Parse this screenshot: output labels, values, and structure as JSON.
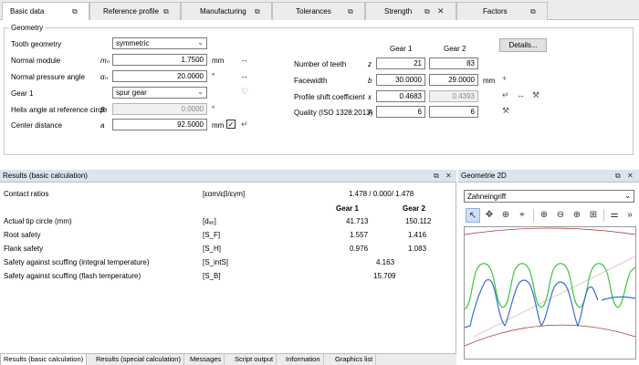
{
  "tabs": [
    {
      "label": "Basic data",
      "active": true,
      "closable": false
    },
    {
      "label": "Reference profile",
      "active": false,
      "closable": false
    },
    {
      "label": "Manufacturing",
      "active": false,
      "closable": false
    },
    {
      "label": "Tolerances",
      "active": false,
      "closable": false
    },
    {
      "label": "Strength",
      "active": false,
      "closable": true
    },
    {
      "label": "Factors",
      "active": false,
      "closable": false
    }
  ],
  "geometry": {
    "legend": "Geometry",
    "details_button": "Details...",
    "col_gear1": "Gear 1",
    "col_gear2": "Gear 2",
    "tooth_geometry": {
      "label": "Tooth geometry",
      "value": "symmetric"
    },
    "normal_module": {
      "label": "Normal module",
      "symbol": "mₙ",
      "value": "1.7500",
      "unit": "mm"
    },
    "normal_pressure_angle": {
      "label": "Normal pressure angle",
      "symbol": "αₙ",
      "value": "20.0000",
      "unit": "°"
    },
    "gear1_type": {
      "label": "Gear 1",
      "value": "spur gear"
    },
    "helix_angle": {
      "label": "Helix angle at reference circle",
      "symbol": "β",
      "value": "0.0000",
      "unit": "°"
    },
    "center_distance": {
      "label": "Center distance",
      "symbol": "a",
      "value": "92.5000",
      "unit": "mm",
      "check": "✓"
    },
    "number_of_teeth": {
      "label": "Number of teeth",
      "symbol": "z",
      "gear1": "21",
      "gear2": "83"
    },
    "facewidth": {
      "label": "Facewidth",
      "symbol": "b",
      "gear1": "30.0000",
      "gear2": "29.0000",
      "unit": "mm"
    },
    "profile_shift": {
      "label": "Profile shift coefficient",
      "symbol": "x",
      "gear1": "0.4683",
      "gear2": "0.4393"
    },
    "quality": {
      "label": "Quality (ISO 1328:2013)",
      "symbol": "A",
      "gear1": "6",
      "gear2": "6"
    }
  },
  "results": {
    "title": "Results (basic calculation)",
    "col_gear1": "Gear 1",
    "col_gear2": "Gear 2",
    "contact_ratios": {
      "label": "Contact ratios",
      "symbol": "[εαm/εβ/εγm]",
      "value": "1.478 / 0.000/ 1.478"
    },
    "rows": [
      {
        "label": "Actual tip circle (mm)",
        "symbol": "[dₐₑ]",
        "gear1": "41.713",
        "gear2": "150.112"
      },
      {
        "label": "Root safety",
        "symbol": "[S_F]",
        "gear1": "1.557",
        "gear2": "1.416"
      },
      {
        "label": "Flank safety",
        "symbol": "[S_H]",
        "gear1": "0.976",
        "gear2": "1.083"
      }
    ],
    "scuffing_integral": {
      "label": "Safety against scuffing (integral temperature)",
      "symbol": "[S_intS]",
      "value": "4.163"
    },
    "scuffing_flash": {
      "label": "Safety against scuffing (flash temperature)",
      "symbol": "[S_B]",
      "value": "15.709"
    }
  },
  "bottom_tabs": [
    "Results (basic calculation)",
    "Results (special calculation)",
    "Messages",
    "Script output",
    "Information",
    "Graphics list"
  ],
  "g2d": {
    "title": "Geometrie 2D",
    "view_select": "Zahneingriff"
  },
  "colors": {
    "tab_bg": "#ececec",
    "panel_title_bg": "#dde4ee",
    "gear1_profile": "#3a6fd0",
    "gear2_profile": "#3cc43c",
    "circle_line": "#b03030"
  }
}
